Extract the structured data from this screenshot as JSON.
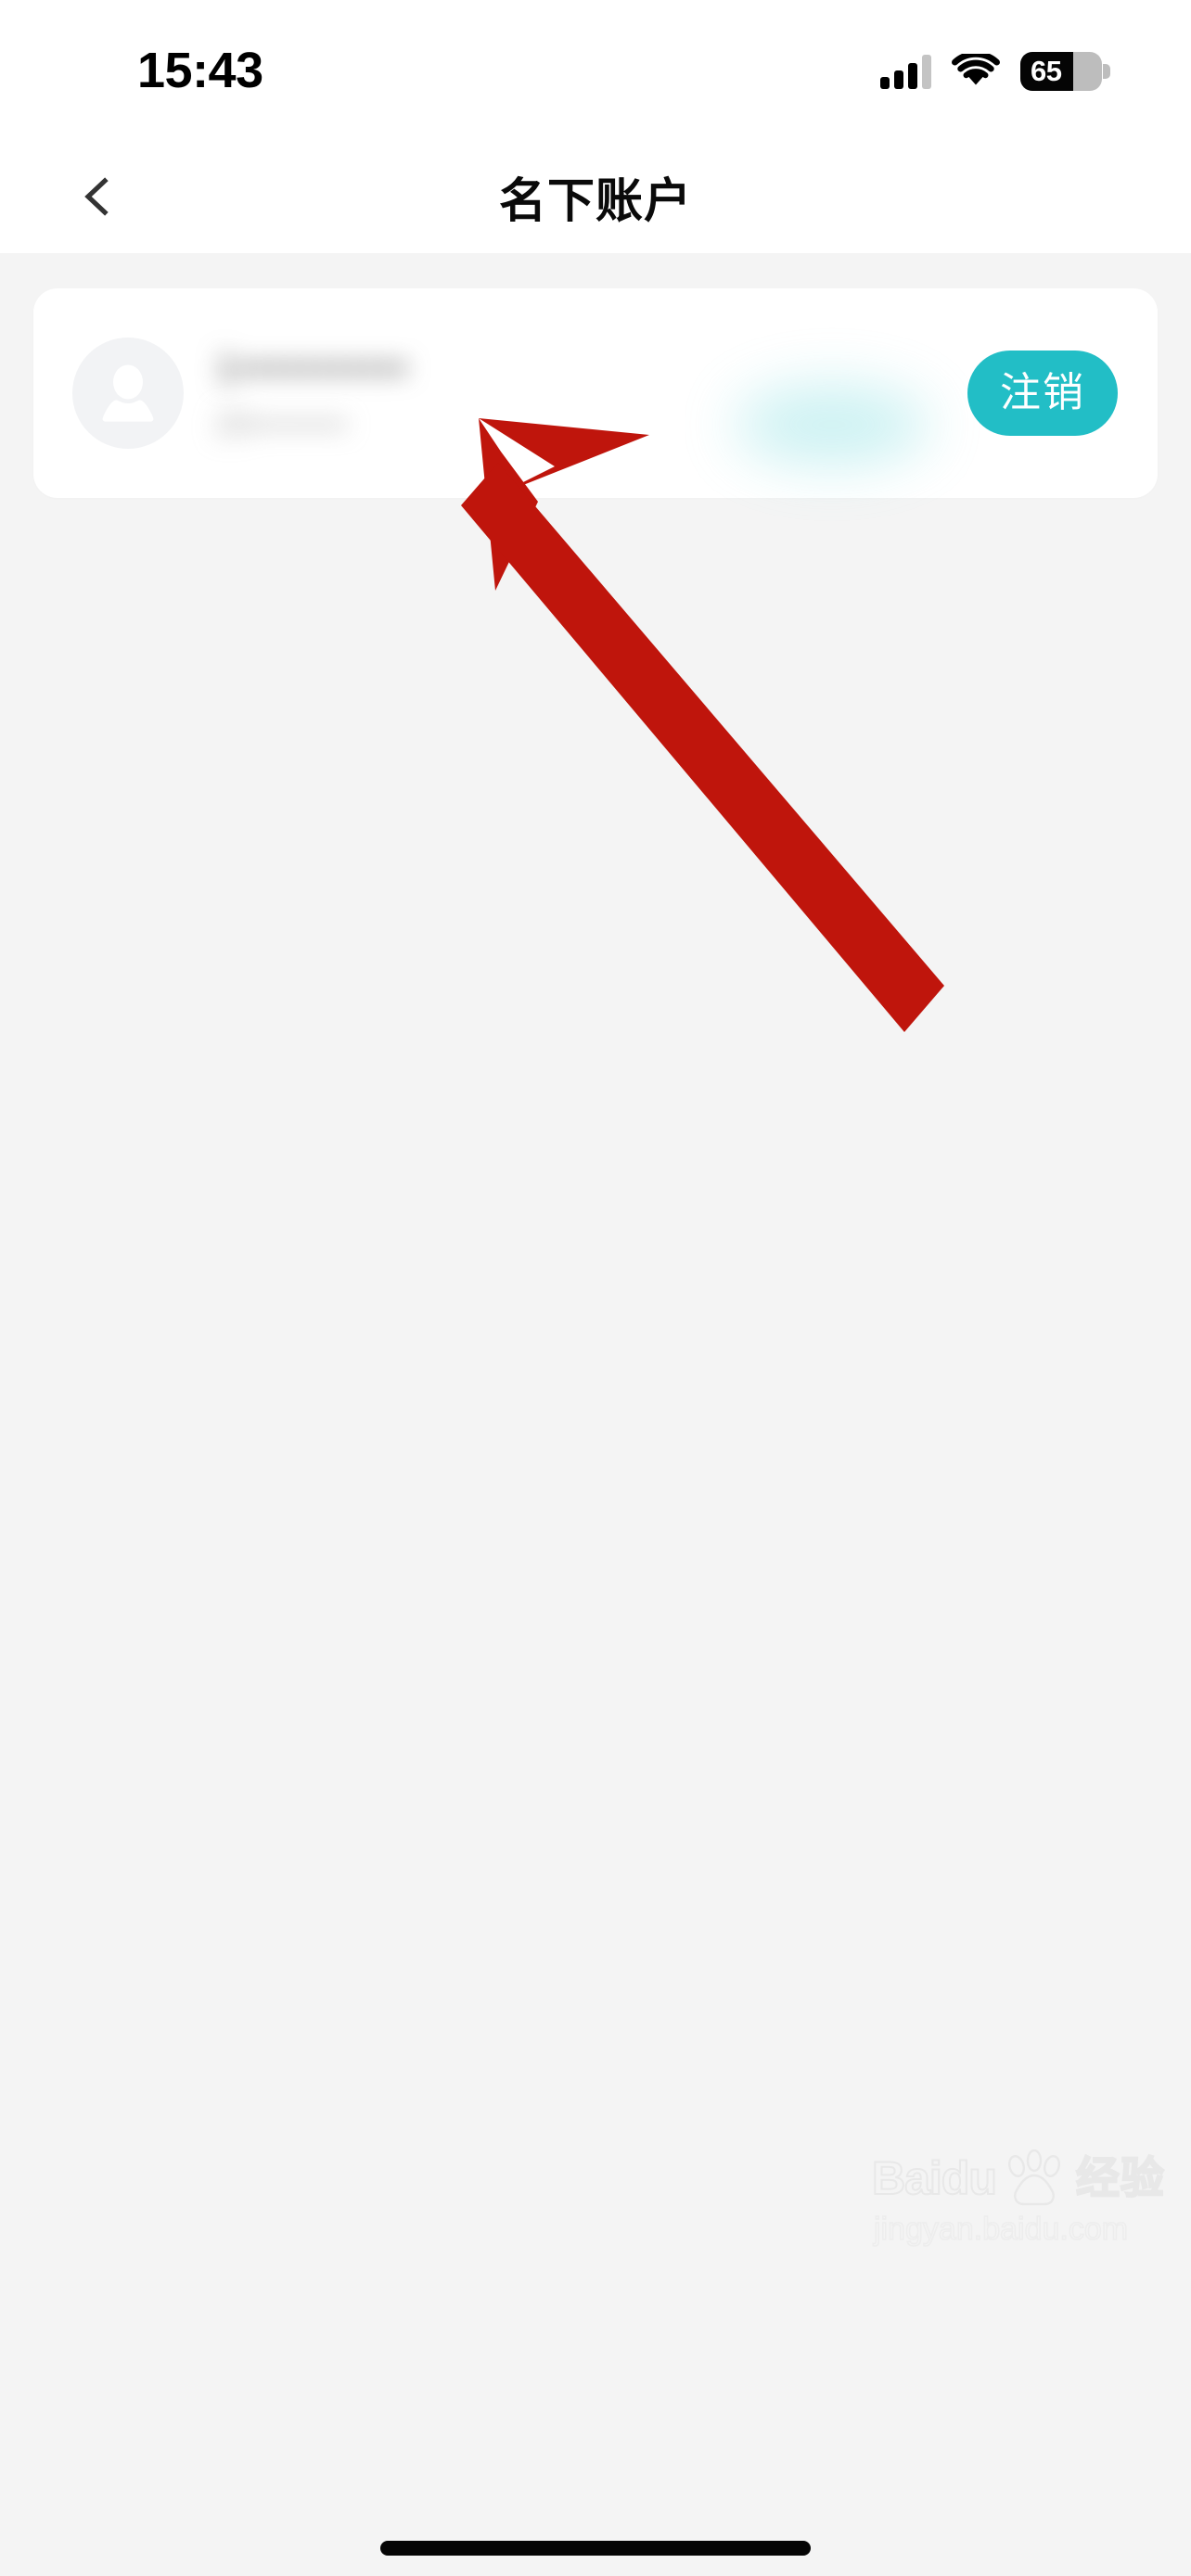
{
  "statusbar": {
    "time": "15:43",
    "signal_icon": "cellular-signal-icon",
    "signal_bars_total": 4,
    "signal_bars_filled": 3,
    "wifi_icon": "wifi-icon",
    "battery_icon": "battery-icon",
    "battery_percent": "65",
    "battery_level": 65
  },
  "navbar": {
    "back_icon": "chevron-left-icon",
    "title": "名下账户"
  },
  "account_card": {
    "avatar_icon": "person-avatar-icon",
    "primary_text": "1•••••••••••",
    "secondary_text": "20••••••••",
    "deregister_label": "注销"
  },
  "annotation": {
    "arrow_icon": "arrow-up-left-icon",
    "arrow_color": "#bf150c"
  },
  "watermark": {
    "brand": "Baidu",
    "brand_cn": "经验",
    "paw_icon": "baidu-paw-icon",
    "url": "jingyan.baidu.com"
  },
  "colors": {
    "accent_teal": "#22bec6",
    "page_background": "#f4f4f4",
    "card_background": "#ffffff",
    "title_text": "#0a0a0a",
    "arrow_red": "#bf150c"
  },
  "home_indicator": {
    "label": "home-indicator"
  }
}
